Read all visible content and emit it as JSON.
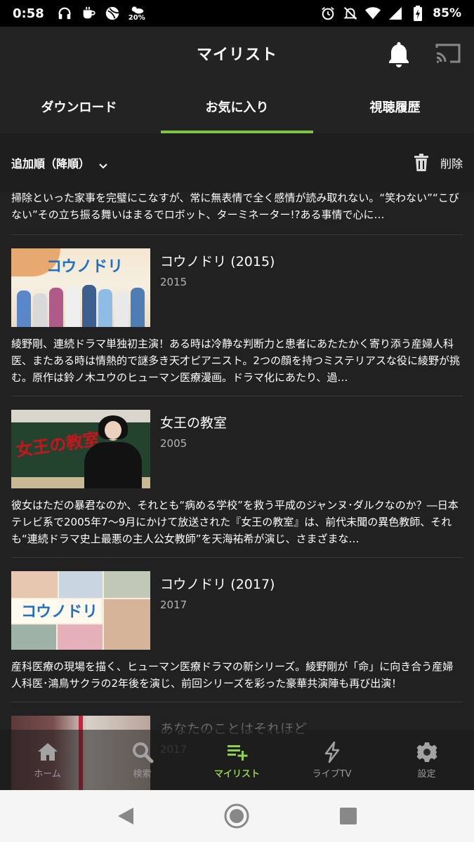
{
  "status_bar": {
    "time": "0:58",
    "weather_percent": "20%",
    "battery": "85%"
  },
  "header": {
    "title": "マイリスト"
  },
  "tabs": [
    {
      "label": "ダウンロード",
      "active": false
    },
    {
      "label": "お気に入り",
      "active": true
    },
    {
      "label": "視聴履歴",
      "active": false
    }
  ],
  "sort": {
    "label": "追加順（降順）",
    "delete_label": "削除"
  },
  "partial_top_desc": "掃除といった家事を完璧にこなすが、常に無表情で全く感情が読み取れない。“笑わない”“こびない”その立ち振る舞いはまるでロボット、ターミネーター!?ある事情で心に…",
  "items": [
    {
      "title": "コウノドリ (2015)",
      "year": "2015",
      "thumb_text": "コウノドリ",
      "desc": "綾野剛、連続ドラマ単独初主演！ある時は冷静な判断力と患者にあたたかく寄り添う産婦人科医、またある時は情熱的で謎多き天才ピアニスト。2つの顔を持つミステリアスな役に綾野が挑む。原作は鈴ノ木ユウのヒューマン医療漫画。ドラマ化にあたり、過…"
    },
    {
      "title": "女王の教室",
      "year": "2005",
      "thumb_text": "女王の教室",
      "desc": "彼女はただの暴君なのか、それとも“病める学校”を救う平成のジャンヌ･ダルクなのか？―日本テレビ系で2005年7～9月にかけて放送された『女王の教室』は、前代未聞の異色教師、それも“連続ドラマ史上最悪の主人公女教師”を天海祐希が演じ、さまざまな…"
    },
    {
      "title": "コウノドリ (2017)",
      "year": "2017",
      "thumb_text": "コウノドリ",
      "desc": "産科医療の現場を描く、ヒューマン医療ドラマの新シリーズ。綾野剛が「命」に向き合う産婦人科医･鴻鳥サクラの2年後を演じ、前回シリーズを彩った豪華共演陣も再び出演！"
    },
    {
      "title": "あなたのことはそれほど",
      "year": "2017",
      "thumb_text": "",
      "desc": ""
    }
  ],
  "bottom_nav": [
    {
      "label": "ホーム",
      "icon": "home-icon",
      "active": false
    },
    {
      "label": "検索",
      "icon": "search-icon",
      "active": false
    },
    {
      "label": "マイリスト",
      "icon": "playlist-add-icon",
      "active": true
    },
    {
      "label": "ライブTV",
      "icon": "lightning-icon",
      "active": false
    },
    {
      "label": "設定",
      "icon": "gear-icon",
      "active": false
    }
  ],
  "colors": {
    "accent": "#7cc444",
    "background": "#212121",
    "header": "#232323"
  }
}
